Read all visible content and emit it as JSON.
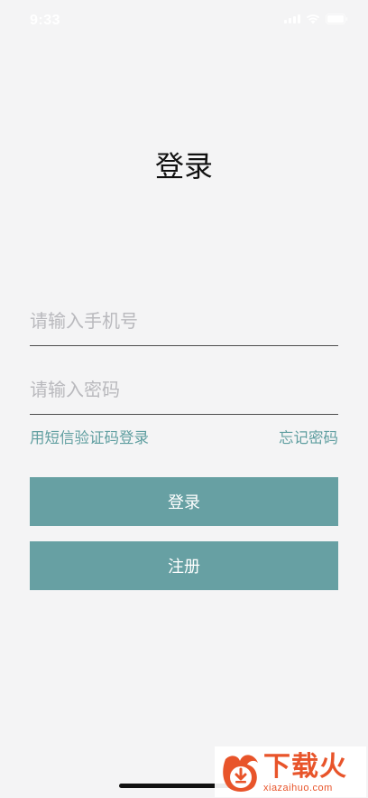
{
  "status_bar": {
    "time": "9:33"
  },
  "page": {
    "title": "登录"
  },
  "form": {
    "phone_placeholder": "请输入手机号",
    "password_placeholder": "请输入密码",
    "sms_login_label": "用短信验证码登录",
    "forgot_password_label": "忘记密码",
    "login_button_label": "登录",
    "register_button_label": "注册"
  },
  "watermark": {
    "name": "下载火",
    "url": "xiazaihuo.com"
  },
  "colors": {
    "accent": "#67a0a3",
    "link": "#5f9ea0",
    "background": "#f4f4f5",
    "watermark": "#e8542a"
  },
  "icons": [
    "signal-icon",
    "wifi-icon",
    "battery-icon",
    "download-fire-logo-icon"
  ]
}
